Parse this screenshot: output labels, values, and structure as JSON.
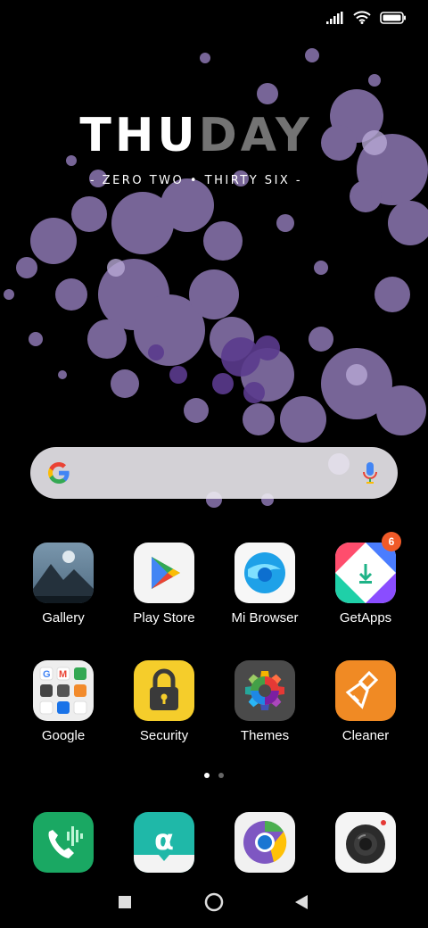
{
  "clock": {
    "day_main": "THU",
    "day_faded": "DAY",
    "time_text": "- ZERO TWO • THIRTY SIX -"
  },
  "apps_row1": [
    {
      "label": "Gallery",
      "icon": "gallery-icon"
    },
    {
      "label": "Play Store",
      "icon": "play-store-icon"
    },
    {
      "label": "Mi Browser",
      "icon": "mi-browser-icon"
    },
    {
      "label": "GetApps",
      "icon": "getapps-icon",
      "badge": "6"
    }
  ],
  "apps_row2": [
    {
      "label": "Google",
      "icon": "google-folder-icon"
    },
    {
      "label": "Security",
      "icon": "security-icon"
    },
    {
      "label": "Themes",
      "icon": "themes-icon"
    },
    {
      "label": "Cleaner",
      "icon": "cleaner-icon"
    }
  ],
  "dock": [
    {
      "icon": "phone-icon"
    },
    {
      "icon": "quick-apps-icon"
    },
    {
      "icon": "chrome-icon"
    },
    {
      "icon": "camera-icon"
    }
  ],
  "colors": {
    "splatter": "#9b82c2",
    "splatter_dark": "#6d4a9c",
    "badge": "#f05a28"
  }
}
